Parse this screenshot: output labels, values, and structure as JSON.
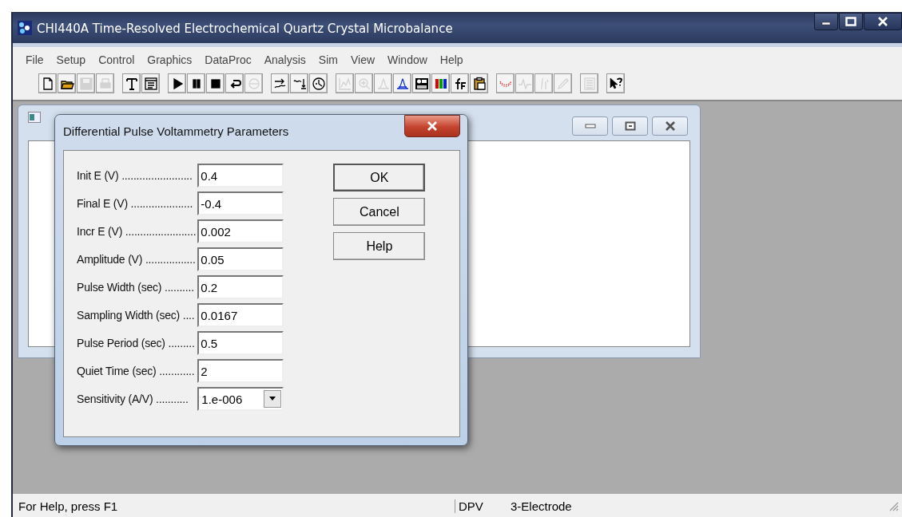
{
  "window": {
    "title": "CHI440A Time-Resolved Electrochemical Quartz Crystal Microbalance"
  },
  "menu": [
    "File",
    "Setup",
    "Control",
    "Graphics",
    "DataProc",
    "Analysis",
    "Sim",
    "View",
    "Window",
    "Help"
  ],
  "toolbar_groups": [
    [
      {
        "disabled": false
      },
      {
        "disabled": false
      },
      {
        "disabled": true
      },
      {
        "disabled": true
      }
    ],
    [
      {
        "disabled": false
      },
      {
        "disabled": false
      }
    ],
    [
      {
        "disabled": false
      },
      {
        "disabled": false
      },
      {
        "disabled": false
      },
      {
        "disabled": false
      },
      {
        "disabled": true
      }
    ],
    [
      {
        "disabled": false
      },
      {
        "disabled": false
      },
      {
        "disabled": false
      }
    ],
    [
      {
        "disabled": true
      },
      {
        "disabled": true
      },
      {
        "disabled": true
      },
      {
        "disabled": false
      },
      {
        "disabled": false
      },
      {
        "disabled": false
      },
      {
        "disabled": false
      },
      {
        "disabled": false
      }
    ],
    [
      {
        "disabled": false
      },
      {
        "disabled": true
      },
      {
        "disabled": true
      },
      {
        "disabled": true
      }
    ],
    [
      {
        "disabled": true
      }
    ],
    [
      {
        "disabled": false
      }
    ]
  ],
  "dialog": {
    "title": "Differential Pulse Voltammetry Parameters",
    "fields": [
      {
        "kind": "text",
        "label": "Init E (V) ........................",
        "value": "0.4"
      },
      {
        "kind": "text",
        "label": "Final E (V) .....................",
        "value": "-0.4"
      },
      {
        "kind": "text",
        "label": "Incr E (V) ........................",
        "value": "0.002"
      },
      {
        "kind": "text",
        "label": "Amplitude (V) .................",
        "value": "0.05"
      },
      {
        "kind": "text",
        "label": "Pulse Width (sec) ..........",
        "value": "0.2"
      },
      {
        "kind": "text",
        "label": "Sampling Width (sec) ....",
        "value": "0.0167"
      },
      {
        "kind": "text",
        "label": "Pulse Period (sec) .........",
        "value": "0.5"
      },
      {
        "kind": "text",
        "label": "Quiet Time (sec) ............",
        "value": "2"
      },
      {
        "kind": "dropdown",
        "label": "Sensitivity (A/V) ...........",
        "value": "1.e-006"
      }
    ],
    "buttons": [
      "OK",
      "Cancel",
      "Help"
    ]
  },
  "status_bar": [
    "For Help, press F1",
    "DPV",
    "3-Electrode"
  ]
}
